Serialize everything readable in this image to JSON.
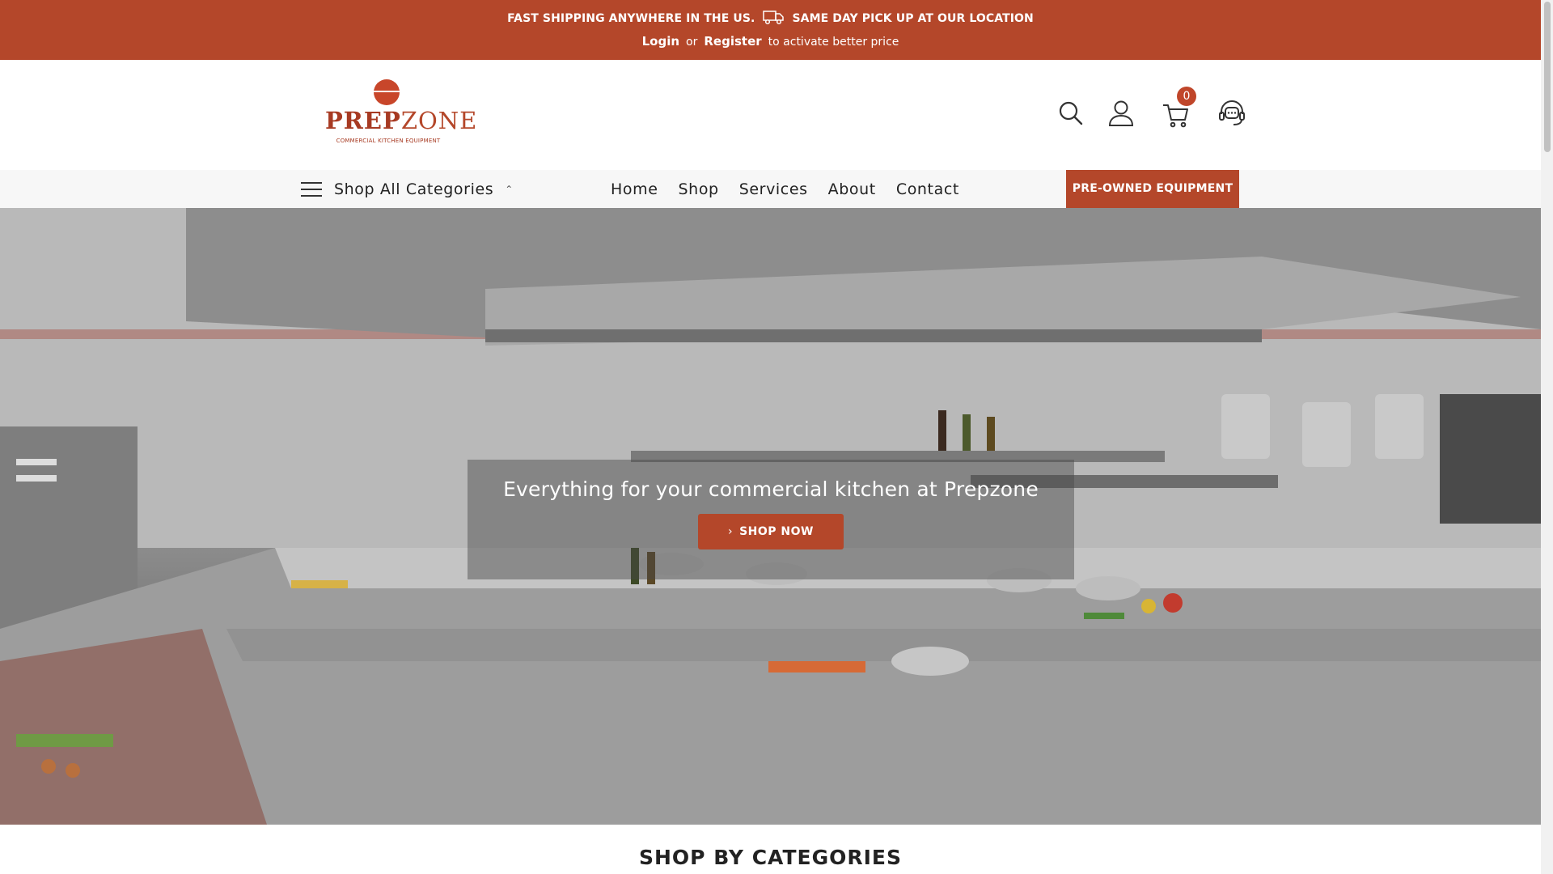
{
  "topbar": {
    "shipping_text": "FAST SHIPPING ANYWHERE IN THE US.",
    "pickup_text": "SAME DAY PICK UP AT OUR LOCATION",
    "login_label": "Login",
    "or_text": "or",
    "register_label": "Register",
    "activate_text": "to activate better price",
    "bg_color": "#b4472a"
  },
  "logo": {
    "word_bold": "PREP",
    "word_light": "ZONE",
    "tagline": "COMMERCIAL KITCHEN EQUIPMENT"
  },
  "header_icons": [
    "search-icon",
    "account-icon",
    "cart-icon",
    "support-icon"
  ],
  "cart": {
    "count": "0"
  },
  "nav": {
    "categories_label": "Shop All Categories",
    "items": [
      {
        "label": "Home"
      },
      {
        "label": "Shop"
      },
      {
        "label": "Services"
      },
      {
        "label": "About"
      },
      {
        "label": "Contact"
      }
    ],
    "preowned_label": "PRE-OWNED EQUIPMENT"
  },
  "hero": {
    "title": "Everything for your commercial kitchen at Prepzone",
    "button_label": "SHOP NOW"
  },
  "sections": {
    "categories_title": "SHOP BY CATEGORIES"
  },
  "colors": {
    "accent": "#b4472a",
    "nav_bg": "#f7f7f7"
  }
}
